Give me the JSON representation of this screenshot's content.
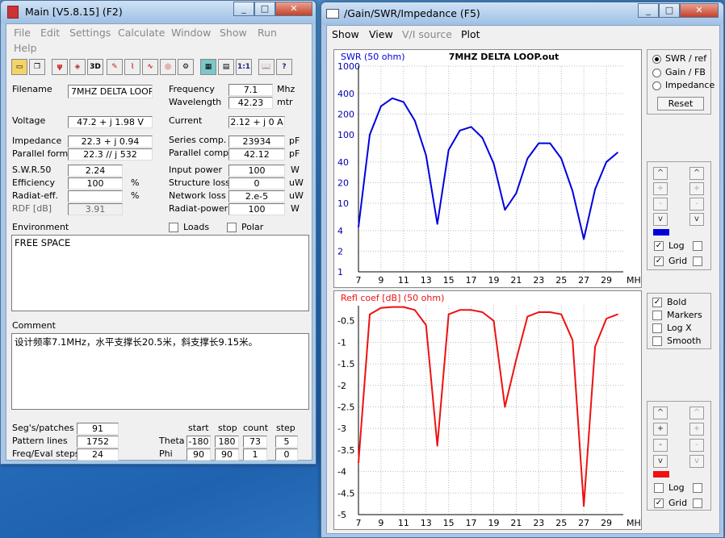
{
  "main": {
    "title": "Main [V5.8.15]  (F2)",
    "menu": [
      "File",
      "Edit",
      "Settings",
      "Calculate",
      "Window",
      "Show",
      "Run",
      "Help"
    ],
    "fields": {
      "filename": {
        "label": "Filename",
        "value": "7MHZ DELTA LOOP"
      },
      "frequency": {
        "label": "Frequency",
        "value": "7.1",
        "unit": "Mhz"
      },
      "wavelength": {
        "label": "Wavelength",
        "value": "42.23",
        "unit": "mtr"
      },
      "voltage": {
        "label": "Voltage",
        "value": "47.2 + j 1.98 V"
      },
      "current": {
        "label": "Current",
        "value": "2.12 + j 0 A"
      },
      "impedance": {
        "label": "Impedance",
        "value": "22.3 + j 0.94"
      },
      "series_comp": {
        "label": "Series comp.",
        "value": "23934",
        "unit": "pF"
      },
      "parallel_form": {
        "label": "Parallel form",
        "value": "22.3 // j 532"
      },
      "parallel_comp": {
        "label": "Parallel comp.",
        "value": "42.12",
        "unit": "pF"
      },
      "swr50": {
        "label": "S.W.R.50",
        "value": "2.24"
      },
      "input_power": {
        "label": "Input power",
        "value": "100",
        "unit": "W"
      },
      "efficiency": {
        "label": "Efficiency",
        "value": "100",
        "unit": "%"
      },
      "structure_loss": {
        "label": "Structure loss",
        "value": "0",
        "unit": "uW"
      },
      "radiat_eff": {
        "label": "Radiat-eff.",
        "value": "",
        "unit": "%"
      },
      "network_loss": {
        "label": "Network loss",
        "value": "2.e-5",
        "unit": "uW"
      },
      "rdf": {
        "label": "RDF [dB]",
        "value": "3.91"
      },
      "radiat_power": {
        "label": "Radiat-power",
        "value": "100",
        "unit": "W"
      }
    },
    "environment": {
      "label": "Environment",
      "loads": "Loads",
      "polar": "Polar",
      "text": "FREE SPACE"
    },
    "comment": {
      "label": "Comment",
      "text": "设计频率7.1MHz，水平支撑长20.5米，斜支撑长9.15米。"
    },
    "bottom": {
      "segs_label": "Seg's/patches",
      "segs": "91",
      "pattern_label": "Pattern lines",
      "pattern": "1752",
      "freq_label": "Freq/Eval steps",
      "freq": "24",
      "headers": [
        "start",
        "stop",
        "count",
        "step"
      ],
      "theta_label": "Theta",
      "theta": [
        "-180",
        "180",
        "73",
        "5"
      ],
      "phi_label": "Phi",
      "phi": [
        "90",
        "90",
        "1",
        "0"
      ]
    }
  },
  "plotwin": {
    "title": "/Gain/SWR/Impedance (F5)",
    "menu": [
      "Show",
      "View",
      "V/I source",
      "Plot"
    ],
    "radio": [
      "SWR / ref",
      "Gain / FB",
      "Impedance"
    ],
    "reset": "Reset",
    "top_checks": {
      "log": "Log",
      "grid": "Grid"
    },
    "style_checks": [
      "Bold",
      "Markers",
      "Log X",
      "Smooth"
    ],
    "bottom_checks": {
      "log": "Log",
      "grid": "Grid"
    },
    "colors": {
      "swr": "#0000dd",
      "refl": "#ee1111"
    }
  },
  "chart_data": [
    {
      "type": "line",
      "title": "7MHZ DELTA LOOP.out",
      "ylabel": "SWR (50 ohm)",
      "xlabel": "MHz",
      "xticks": [
        "7",
        "9",
        "11",
        "13",
        "15",
        "17",
        "19",
        "21",
        "23",
        "25",
        "27",
        "29"
      ],
      "yticks": [
        "1000",
        "400",
        "200",
        "100",
        "40",
        "20",
        "10",
        "4",
        "2",
        "1"
      ],
      "yscale": "log",
      "xlim": [
        7,
        30.5
      ],
      "ylim": [
        1,
        1000
      ],
      "x": [
        7,
        8,
        9,
        10,
        11,
        12,
        13,
        14,
        15,
        16,
        17,
        18,
        19,
        20,
        21,
        22,
        23,
        24,
        25,
        26,
        27,
        28,
        29,
        30
      ],
      "series": [
        {
          "values": [
            4.5,
            100,
            260,
            340,
            300,
            160,
            50,
            5,
            60,
            115,
            130,
            90,
            38,
            8,
            14,
            45,
            75,
            75,
            45,
            15,
            3,
            16,
            40,
            55
          ]
        }
      ]
    },
    {
      "type": "line",
      "ylabel": "Refl coef [dB] (50 ohm)",
      "xlabel": "MHz",
      "xticks": [
        "7",
        "9",
        "11",
        "13",
        "15",
        "17",
        "19",
        "21",
        "23",
        "25",
        "27",
        "29"
      ],
      "yticks": [
        "-0.5",
        "-1",
        "-1.5",
        "-2",
        "-2.5",
        "-3",
        "-3.5",
        "-4",
        "-4.5",
        "-5"
      ],
      "xlim": [
        7,
        30.5
      ],
      "ylim": [
        -5,
        -0.15
      ],
      "x": [
        7,
        8,
        9,
        10,
        11,
        12,
        13,
        14,
        15,
        16,
        17,
        18,
        19,
        20,
        21,
        22,
        23,
        24,
        25,
        26,
        27,
        28,
        29,
        30
      ],
      "series": [
        {
          "values": [
            -3.8,
            -0.35,
            -0.2,
            -0.18,
            -0.18,
            -0.25,
            -0.6,
            -3.4,
            -0.35,
            -0.25,
            -0.25,
            -0.3,
            -0.5,
            -2.5,
            -1.4,
            -0.4,
            -0.3,
            -0.3,
            -0.35,
            -0.95,
            -4.8,
            -1.1,
            -0.45,
            -0.35
          ]
        }
      ]
    }
  ]
}
